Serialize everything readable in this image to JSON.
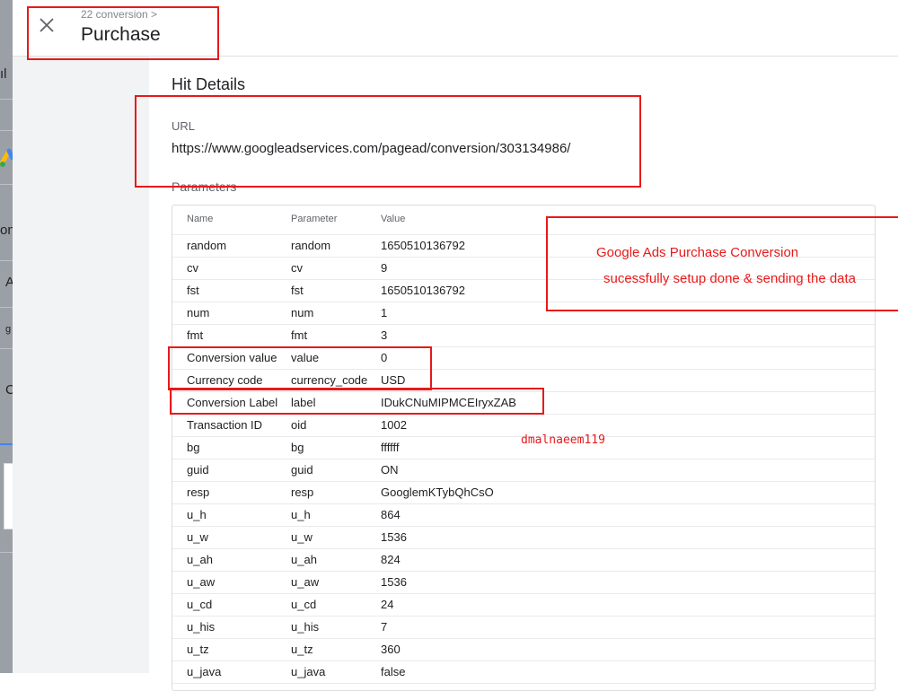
{
  "header": {
    "breadcrumb": "22 conversion >",
    "title": "Purchase",
    "close_icon": "close-icon"
  },
  "background_app": {
    "stubs": [
      "ıl",
      "on",
      "A",
      "g",
      "C"
    ]
  },
  "hit_details": {
    "title": "Hit Details",
    "url_label": "URL",
    "url_value": "https://www.googleadservices.com/pagead/conversion/303134986/",
    "parameters_label": "Parameters"
  },
  "parameters": {
    "columns": [
      "Name",
      "Parameter",
      "Value"
    ],
    "rows": [
      {
        "name": "random",
        "parameter": "random",
        "value": "1650510136792"
      },
      {
        "name": "cv",
        "parameter": "cv",
        "value": "9"
      },
      {
        "name": "fst",
        "parameter": "fst",
        "value": "1650510136792"
      },
      {
        "name": "num",
        "parameter": "num",
        "value": "1"
      },
      {
        "name": "fmt",
        "parameter": "fmt",
        "value": "3"
      },
      {
        "name": "Conversion value",
        "parameter": "value",
        "value": "0"
      },
      {
        "name": "Currency code",
        "parameter": "currency_code",
        "value": "USD"
      },
      {
        "name": "Conversion Label",
        "parameter": "label",
        "value": "IDukCNuMIPMCEIryxZAB"
      },
      {
        "name": "Transaction ID",
        "parameter": "oid",
        "value": "1002"
      },
      {
        "name": "bg",
        "parameter": "bg",
        "value": "ffffff"
      },
      {
        "name": "guid",
        "parameter": "guid",
        "value": "ON"
      },
      {
        "name": "resp",
        "parameter": "resp",
        "value": "GooglemKTybQhCsO"
      },
      {
        "name": "u_h",
        "parameter": "u_h",
        "value": "864"
      },
      {
        "name": "u_w",
        "parameter": "u_w",
        "value": "1536"
      },
      {
        "name": "u_ah",
        "parameter": "u_ah",
        "value": "824"
      },
      {
        "name": "u_aw",
        "parameter": "u_aw",
        "value": "1536"
      },
      {
        "name": "u_cd",
        "parameter": "u_cd",
        "value": "24"
      },
      {
        "name": "u_his",
        "parameter": "u_his",
        "value": "7"
      },
      {
        "name": "u_tz",
        "parameter": "u_tz",
        "value": "360"
      },
      {
        "name": "u_java",
        "parameter": "u_java",
        "value": "false"
      }
    ]
  },
  "annotations": {
    "note_line1": "Google Ads Purchase Conversion",
    "note_line2": "sucessfully setup done & sending the data",
    "watermark": "dmalnaeem119",
    "color": "#e8191a"
  }
}
